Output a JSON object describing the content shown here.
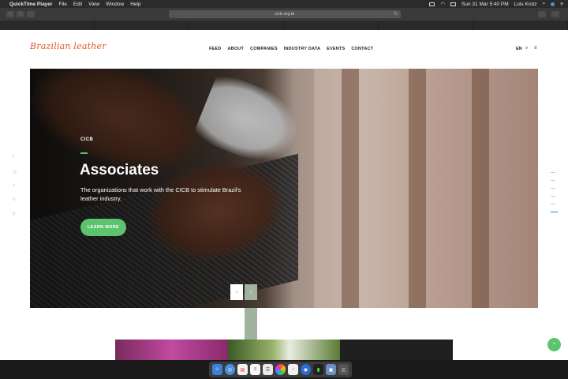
{
  "menubar": {
    "apple": "",
    "app": "QuickTime Player",
    "items": [
      "File",
      "Edit",
      "View",
      "Window",
      "Help"
    ],
    "datetime": "Sun 31 Mar  5:40 PM",
    "user": "Luis Krotz"
  },
  "browser": {
    "url": "cicb.org.br"
  },
  "site": {
    "logo": "Brazilian leather",
    "nav": [
      "FEED",
      "ABOUT",
      "COMPANIES",
      "INDUSTRY DATA",
      "EVENTS",
      "CONTACT"
    ],
    "lang": "EN"
  },
  "hero": {
    "eyebrow": "CICB",
    "title": "Associates",
    "description": "The organizations that work with the CICB to stimulate Brazil's leather industry.",
    "cta": "LEARN MORE",
    "prev": "‹",
    "next": "›"
  },
  "colors": {
    "accent_green": "#5cc36f",
    "logo_orange": "#e8562a",
    "slider_blue": "#2a7fc7"
  },
  "icons": {
    "search": "search-icon",
    "menu": "hamburger-icon",
    "social": [
      "facebook-icon",
      "instagram-icon",
      "vimeo-icon",
      "linkedin-icon",
      "pinterest-icon"
    ]
  }
}
